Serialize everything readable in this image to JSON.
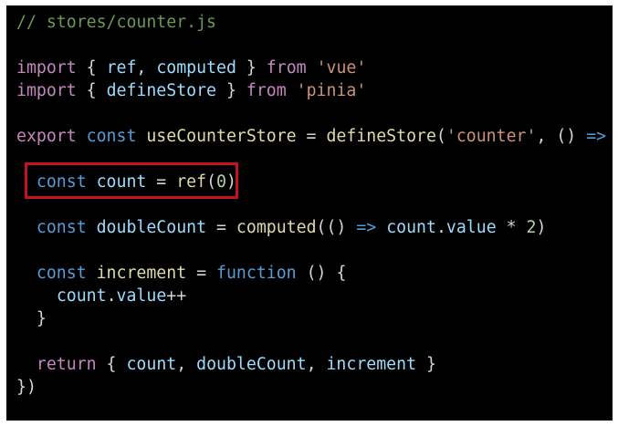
{
  "code": {
    "filename_comment": "// stores/counter.js",
    "lines": [
      {
        "tokens": [
          {
            "t": "// stores/counter.js",
            "k": "comment"
          }
        ]
      },
      {
        "tokens": []
      },
      {
        "tokens": [
          {
            "t": "import",
            "k": "kw"
          },
          {
            "t": " { ",
            "k": "punc"
          },
          {
            "t": "ref",
            "k": "var"
          },
          {
            "t": ", ",
            "k": "punc"
          },
          {
            "t": "computed",
            "k": "var"
          },
          {
            "t": " } ",
            "k": "punc"
          },
          {
            "t": "from",
            "k": "kw"
          },
          {
            "t": " ",
            "k": "punc"
          },
          {
            "t": "'vue'",
            "k": "str"
          }
        ]
      },
      {
        "tokens": [
          {
            "t": "import",
            "k": "kw"
          },
          {
            "t": " { ",
            "k": "punc"
          },
          {
            "t": "defineStore",
            "k": "var"
          },
          {
            "t": " } ",
            "k": "punc"
          },
          {
            "t": "from",
            "k": "kw"
          },
          {
            "t": " ",
            "k": "punc"
          },
          {
            "t": "'pinia'",
            "k": "str"
          }
        ]
      },
      {
        "tokens": []
      },
      {
        "tokens": [
          {
            "t": "export",
            "k": "kw"
          },
          {
            "t": " ",
            "k": "punc"
          },
          {
            "t": "const",
            "k": "decl"
          },
          {
            "t": " ",
            "k": "punc"
          },
          {
            "t": "useCounterStore",
            "k": "fn"
          },
          {
            "t": " = ",
            "k": "punc"
          },
          {
            "t": "defineStore",
            "k": "fn"
          },
          {
            "t": "(",
            "k": "punc"
          },
          {
            "t": "'counter'",
            "k": "str"
          },
          {
            "t": ", () ",
            "k": "punc"
          },
          {
            "t": "=>",
            "k": "decl"
          },
          {
            "t": " {",
            "k": "punc"
          }
        ]
      },
      {
        "tokens": []
      },
      {
        "tokens": [
          {
            "t": "  ",
            "k": "punc"
          },
          {
            "t": "const",
            "k": "decl"
          },
          {
            "t": " ",
            "k": "punc"
          },
          {
            "t": "count",
            "k": "var"
          },
          {
            "t": " = ",
            "k": "punc"
          },
          {
            "t": "ref",
            "k": "fn"
          },
          {
            "t": "(",
            "k": "punc"
          },
          {
            "t": "0",
            "k": "num"
          },
          {
            "t": ")",
            "k": "punc"
          }
        ]
      },
      {
        "tokens": []
      },
      {
        "tokens": [
          {
            "t": "  ",
            "k": "punc"
          },
          {
            "t": "const",
            "k": "decl"
          },
          {
            "t": " ",
            "k": "punc"
          },
          {
            "t": "doubleCount",
            "k": "var"
          },
          {
            "t": " = ",
            "k": "punc"
          },
          {
            "t": "computed",
            "k": "fn"
          },
          {
            "t": "(() ",
            "k": "punc"
          },
          {
            "t": "=>",
            "k": "decl"
          },
          {
            "t": " ",
            "k": "punc"
          },
          {
            "t": "count",
            "k": "var"
          },
          {
            "t": ".",
            "k": "punc"
          },
          {
            "t": "value",
            "k": "var"
          },
          {
            "t": " * ",
            "k": "punc"
          },
          {
            "t": "2",
            "k": "num"
          },
          {
            "t": ")",
            "k": "punc"
          }
        ]
      },
      {
        "tokens": []
      },
      {
        "tokens": [
          {
            "t": "  ",
            "k": "punc"
          },
          {
            "t": "const",
            "k": "decl"
          },
          {
            "t": " ",
            "k": "punc"
          },
          {
            "t": "increment",
            "k": "fn"
          },
          {
            "t": " = ",
            "k": "punc"
          },
          {
            "t": "function",
            "k": "decl"
          },
          {
            "t": " () {",
            "k": "punc"
          }
        ]
      },
      {
        "tokens": [
          {
            "t": "    ",
            "k": "punc"
          },
          {
            "t": "count",
            "k": "var"
          },
          {
            "t": ".",
            "k": "punc"
          },
          {
            "t": "value",
            "k": "var"
          },
          {
            "t": "++",
            "k": "punc"
          }
        ]
      },
      {
        "tokens": [
          {
            "t": "  }",
            "k": "punc"
          }
        ]
      },
      {
        "tokens": []
      },
      {
        "tokens": [
          {
            "t": "  ",
            "k": "punc"
          },
          {
            "t": "return",
            "k": "kw"
          },
          {
            "t": " { ",
            "k": "punc"
          },
          {
            "t": "count",
            "k": "var"
          },
          {
            "t": ", ",
            "k": "punc"
          },
          {
            "t": "doubleCount",
            "k": "var"
          },
          {
            "t": ", ",
            "k": "punc"
          },
          {
            "t": "increment",
            "k": "var"
          },
          {
            "t": " }",
            "k": "punc"
          }
        ]
      },
      {
        "tokens": [
          {
            "t": "})",
            "k": "punc"
          }
        ]
      }
    ]
  },
  "highlight": {
    "color": "#c4141b",
    "line_index": 7
  },
  "colors": {
    "background": "#000000",
    "comment": "#6a9955",
    "keyword": "#c586c0",
    "declaration": "#569cd6",
    "variable": "#9cdcfe",
    "function": "#dcdcaa",
    "string": "#ce9178",
    "number": "#b5cea8",
    "punctuation": "#d4d4d4"
  }
}
